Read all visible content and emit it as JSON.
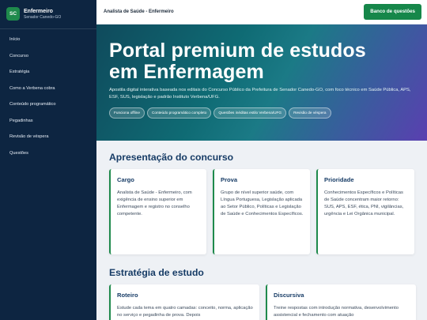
{
  "brand": {
    "logo": "SC",
    "title": "Enfermeiro",
    "subtitle": "Senador Canedo-GO"
  },
  "sidebar": {
    "items": [
      {
        "label": "Início"
      },
      {
        "label": "Concurso"
      },
      {
        "label": "Estratégia"
      },
      {
        "label": "Como a Verbena cobra"
      },
      {
        "label": "Conteúdo programático"
      },
      {
        "label": "Pegadinhas"
      },
      {
        "label": "Revisão de véspera"
      },
      {
        "label": "Questões"
      }
    ]
  },
  "header": {
    "title": "Analista de Saúde - Enfermeiro",
    "cta_label": "Banco de questões"
  },
  "hero": {
    "title_line1": "Portal premium de estudos",
    "title_line2": "em Enfermagem",
    "description": "Apostila digital interativa baseada nos editais do Concurso Público da Prefeitura de Senador Canedo-GO, com foco técnico em Saúde Pública, APS, ESF, SUS, legislação e padrão Instituto Verbena/UFG.",
    "chips": [
      {
        "label": "Funciona offline"
      },
      {
        "label": "Conteúdo programático completo"
      },
      {
        "label": "Questões inéditas estilo Verbena/UFG"
      },
      {
        "label": "Revisão de véspera"
      }
    ]
  },
  "sections": {
    "overview": {
      "title": "Apresentação do concurso",
      "cards": [
        {
          "title": "Cargo",
          "text": "Analista de Saúde - Enfermeiro, com exigência de ensino superior em Enfermagem e registro no conselho competente."
        },
        {
          "title": "Prova",
          "text": "Grupo de nível superior saúde, com Língua Portuguesa, Legislação aplicada ao Setor Público, Políticas e Legislação de Saúde e Conhecimentos Específicos."
        },
        {
          "title": "Prioridade",
          "text": "Conhecimentos Específicos e Políticas de Saúde concentram maior retorno: SUS, APS, ESF, ética, PNI, vigilâncias, urgência e Lei Orgânica municipal."
        }
      ]
    },
    "strategy": {
      "title": "Estratégia de estudo",
      "cards": [
        {
          "title": "Roteiro",
          "text": "Estude cada tema em quatro camadas: conceito, norma, aplicação no serviço e pegadinha de prova. Depois"
        },
        {
          "title": "Discursiva",
          "text": "Treine respostas com introdução normativa, desenvolvimento assistencial e fechamento com atuação"
        }
      ]
    }
  },
  "colors": {
    "sidebar": "#0d2541",
    "accent_green": "#16874a",
    "heading_blue": "#173c66"
  }
}
